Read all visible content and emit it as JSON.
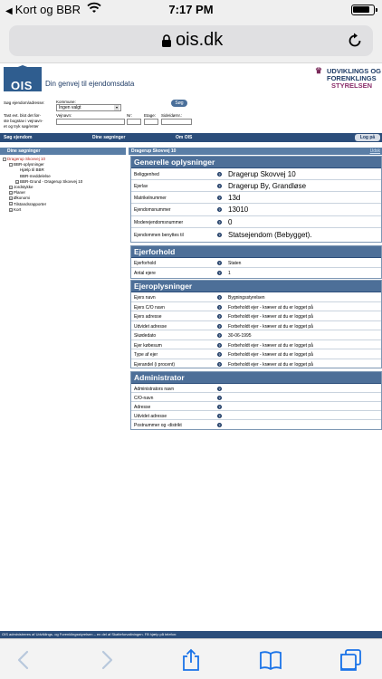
{
  "status_bar": {
    "back_app": "Kort og BBR",
    "time": "7:17 PM",
    "battery_level": 0.85
  },
  "browser": {
    "url": "ois.dk"
  },
  "site": {
    "logo_text": "OIS",
    "tagline": "Din genvej til ejendomsdata",
    "agency_line1": "UDVIKLINGS OG",
    "agency_line2": "FORENKLINGS",
    "agency_line3": "STYRELSEN"
  },
  "search": {
    "label_main": "Søg ejendom/adresse:",
    "kommune_label": "Kommune:",
    "kommune_value": "Ingen valgt",
    "search_button": "Søg",
    "help_text_1": "Tast evt. blot det før-",
    "help_text_2": "ste bogstav i vejnavn-",
    "help_text_3": "et og tryk søg/enter",
    "vejnavn_label": "Vejnavn:",
    "nr_label": "Nr:",
    "etage_label": "Etage:",
    "side_label": "Side/dørnr.:"
  },
  "nav": {
    "item1": "Søg ejendom",
    "item2": "Dine søgninger",
    "item3": "Om OIS",
    "logout": "Log på"
  },
  "left_panel": {
    "heading": "Dine søgninger",
    "tree": [
      "Dragerup Skovvej 10",
      "BBR-oplysninger",
      "Hjælp til BBR",
      "BBR-meddelelse",
      "BBR-Grund - Dragerup Skovvej 10",
      "Jordstykke",
      "Planer",
      "Økonomi",
      "Tilstandsrapporter",
      "Kort"
    ]
  },
  "right_panel": {
    "heading": "Dragerup Skovvej 10",
    "udskriv": "Udsk",
    "sections": [
      {
        "title": "Generelle oplysninger",
        "rows": [
          {
            "key": "Beliggenhed",
            "value": "Dragerup Skovvej 10"
          },
          {
            "key": "Ejerlav",
            "value": "Dragerup By, Grandløse"
          },
          {
            "key": "Matrikelnummer",
            "value": "13d"
          },
          {
            "key": "Ejendomsnummer",
            "value": "13010"
          },
          {
            "key": "Moderejendomsnummer",
            "value": "0"
          },
          {
            "key": "Ejendommen benyttes til",
            "value": "Statsejendom (Bebygget)."
          }
        ]
      },
      {
        "title": "Ejerforhold",
        "rows": [
          {
            "key": "Ejerforhold",
            "value": "Staten"
          },
          {
            "key": "Antal ejere",
            "value": "1"
          }
        ]
      },
      {
        "title": "Ejeroplysninger",
        "rows": [
          {
            "key": "Ejers navn",
            "value": "Bygningsstyrelsen"
          },
          {
            "key": "Ejers C/O navn",
            "value": "Forbeholdt ejer - kræver at du er logget på"
          },
          {
            "key": "Ejers adresse",
            "value": "Forbeholdt ejer - kræver at du er logget på"
          },
          {
            "key": "Udvidet adresse",
            "value": "Forbeholdt ejer - kræver at du er logget på"
          },
          {
            "key": "Skødedato",
            "value": "30-06-1995"
          },
          {
            "key": "Ejer købesum",
            "value": "Forbeholdt ejer - kræver at du er logget på"
          },
          {
            "key": "Type af ejer",
            "value": "Forbeholdt ejer - kræver at du er logget på"
          },
          {
            "key": "Ejerandel (i procent)",
            "value": "Forbeholdt ejer - kræver at du er logget på"
          }
        ]
      },
      {
        "title": "Administrator",
        "rows": [
          {
            "key": "Administrators navn",
            "value": ""
          },
          {
            "key": "C/O-navn",
            "value": ""
          },
          {
            "key": "Adresse",
            "value": ""
          },
          {
            "key": "Udvidet adresse",
            "value": ""
          },
          {
            "key": "Postnummer og -distrikt",
            "value": ""
          }
        ]
      }
    ]
  },
  "footer": {
    "text": "OIS administreres af Udviklings- og Forenklingsstyrelsen – en del af Skatteforvaltningen. Få hjælp på telefon:"
  },
  "toolbar": {
    "back_icon": "chevron-left-icon",
    "forward_icon": "chevron-right-icon",
    "share_icon": "share-icon",
    "bookmarks_icon": "book-icon",
    "tabs_icon": "tabs-icon"
  }
}
